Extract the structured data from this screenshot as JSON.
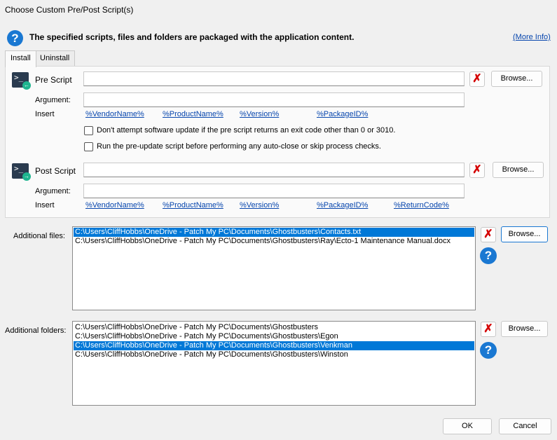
{
  "window": {
    "title": "Choose Custom Pre/Post Script(s)"
  },
  "header": {
    "text": "The specified scripts, files and folders are packaged with the application content.",
    "more_info": "(More Info)"
  },
  "tabs": [
    {
      "label": "Install",
      "active": true
    },
    {
      "label": "Uninstall",
      "active": false
    }
  ],
  "pre_script": {
    "label": "Pre Script",
    "value": "",
    "browse": "Browse...",
    "argument_label": "Argument:",
    "argument_value": "",
    "insert_label": "Insert",
    "variables": [
      "%VendorName%",
      "%ProductName%",
      "%Version%",
      "%PackageID%"
    ],
    "checkbox1": {
      "label": "Don't attempt software update if the pre script returns an exit code other than 0 or 3010.",
      "checked": false
    },
    "checkbox2": {
      "label": "Run the pre-update script before performing any auto-close or skip process checks.",
      "checked": false
    }
  },
  "post_script": {
    "label": "Post Script",
    "value": "",
    "browse": "Browse...",
    "argument_label": "Argument:",
    "argument_value": "",
    "insert_label": "Insert",
    "variables": [
      "%VendorName%",
      "%ProductName%",
      "%Version%",
      "%PackageID%",
      "%ReturnCode%"
    ]
  },
  "additional_files": {
    "label": "Additional files:",
    "browse": "Browse...",
    "items": [
      {
        "path": "C:\\Users\\CliffHobbs\\OneDrive - Patch My PC\\Documents\\Ghostbusters\\Contacts.txt",
        "selected": true
      },
      {
        "path": "C:\\Users\\CliffHobbs\\OneDrive - Patch My PC\\Documents\\Ghostbusters\\Ray\\Ecto-1 Maintenance Manual.docx",
        "selected": false
      }
    ]
  },
  "additional_folders": {
    "label": "Additional folders:",
    "browse": "Browse...",
    "items": [
      {
        "path": "C:\\Users\\CliffHobbs\\OneDrive - Patch My PC\\Documents\\Ghostbusters",
        "selected": false
      },
      {
        "path": "C:\\Users\\CliffHobbs\\OneDrive - Patch My PC\\Documents\\Ghostbusters\\Egon",
        "selected": false
      },
      {
        "path": "C:\\Users\\CliffHobbs\\OneDrive - Patch My PC\\Documents\\Ghostbusters\\Venkman",
        "selected": true
      },
      {
        "path": "C:\\Users\\CliffHobbs\\OneDrive - Patch My PC\\Documents\\Ghostbusters\\Winston",
        "selected": false
      }
    ]
  },
  "footer": {
    "ok": "OK",
    "cancel": "Cancel"
  },
  "colors": {
    "accent": "#1a78d2",
    "selection": "#0078d7",
    "remove": "#d40000",
    "link": "#0645ad"
  }
}
